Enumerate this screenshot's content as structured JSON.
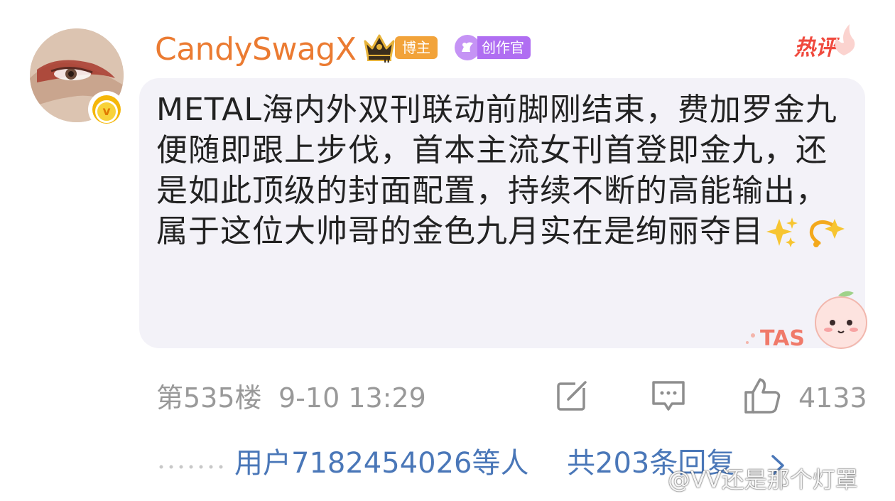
{
  "comment": {
    "username": "CandySwagX",
    "badges": {
      "blogger_label": "博主",
      "creator_label": "创作官"
    },
    "hot_label": "热评",
    "text": "METAL海内外双刊联动前脚刚结束，费加罗金九便随即跟上步伐，首本主流女刊首登即金九，还是如此顶级的封面配置，持续不断的高能输出，属于这位大帅哥的金色九月实在是绚丽夺目",
    "emoji": [
      "sparkles-emoji",
      "dizzy-emoji"
    ],
    "floor": "第535楼",
    "time": "9-10 13:29",
    "like_count": "4133",
    "sticker_text": "TAS"
  },
  "replies": {
    "users_text": "用户7182454026等人",
    "total_text": "共203条回复"
  },
  "watermark": "@VV还是那个灯罩",
  "colors": {
    "username": "#eb7b32",
    "link": "#4a77b8",
    "meta": "#999999",
    "hot": "#f04a3e",
    "bubble": "#f3f2f8",
    "blogger_badge": "#f2a33a",
    "creator_badge": "#b06ef2"
  }
}
